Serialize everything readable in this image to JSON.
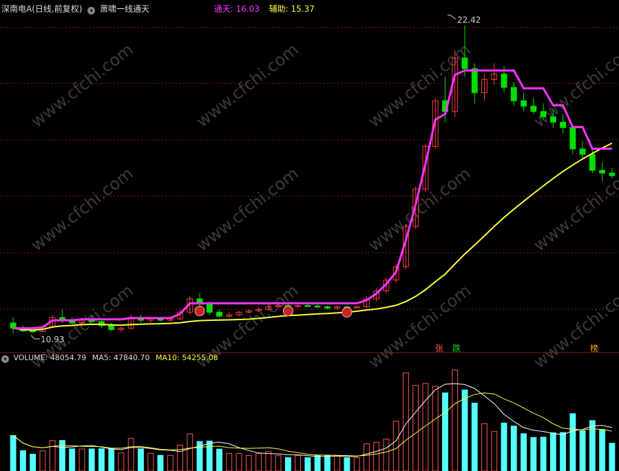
{
  "header": {
    "stock_title": "深南电A(日线,前复权)",
    "indicator_name": "萧啸一线通天",
    "tongtian_label": "通天:",
    "tongtian_value": "16.03",
    "fuzhu_label": "辅助:",
    "fuzhu_value": "15.37"
  },
  "volume_header": {
    "label": "VOLUME:",
    "value": "48054.79",
    "ma5_label": "MA5:",
    "ma5_value": "47840.70",
    "ma10_label": "MA10:",
    "ma10_value": "54255.08"
  },
  "annotations": {
    "high_price": "22.42",
    "low_price": "10.93",
    "marker_zhang": "张",
    "marker_die": "跌",
    "marker_bang": "榜"
  },
  "watermark": "www.cfchi.com",
  "colors": {
    "background": "#000000",
    "up_candle": "#ff3c3c",
    "down_candle": "#00e000",
    "flat_candle": "#ffffff",
    "tongtian_line": "#ff33ff",
    "fuzhu_line": "#ffff33",
    "volume_up": "#ff5555",
    "volume_down": "#55ffff",
    "gridline": "#8b1a1a"
  },
  "chart_data": [
    {
      "type": "candlestick",
      "title": "深南电A(日线,前复权)",
      "y_labeled_points": {
        "high": 22.42,
        "low": 10.93
      },
      "series": [
        {
          "name": "通天",
          "last_value": 16.03
        },
        {
          "name": "辅助",
          "last_value": 15.37
        }
      ],
      "candles": [
        [
          11.3,
          11.5,
          10.9,
          11.1
        ],
        [
          11.1,
          11.2,
          10.95,
          11.0
        ],
        [
          11.0,
          11.1,
          10.93,
          10.98
        ],
        [
          10.98,
          11.2,
          10.95,
          11.15
        ],
        [
          11.15,
          11.6,
          11.1,
          11.5
        ],
        [
          11.5,
          11.8,
          11.3,
          11.4
        ],
        [
          11.4,
          11.5,
          11.2,
          11.3
        ],
        [
          11.3,
          11.5,
          11.2,
          11.45
        ],
        [
          11.45,
          11.6,
          11.3,
          11.35
        ],
        [
          11.35,
          11.4,
          11.1,
          11.2
        ],
        [
          11.2,
          11.3,
          11.0,
          11.05
        ],
        [
          11.05,
          11.15,
          10.95,
          11.1
        ],
        [
          11.1,
          11.6,
          11.05,
          11.5
        ],
        [
          11.5,
          11.6,
          11.3,
          11.4
        ],
        [
          11.4,
          11.5,
          11.3,
          11.45
        ],
        [
          11.45,
          11.5,
          11.35,
          11.4
        ],
        [
          11.4,
          11.5,
          11.35,
          11.45
        ],
        [
          11.45,
          11.8,
          11.4,
          11.7
        ],
        [
          11.7,
          12.3,
          11.6,
          12.2
        ],
        [
          12.2,
          12.4,
          11.9,
          12.0
        ],
        [
          12.0,
          12.1,
          11.6,
          11.7
        ],
        [
          11.7,
          11.8,
          11.5,
          11.55
        ],
        [
          11.55,
          11.7,
          11.5,
          11.6
        ],
        [
          11.6,
          11.75,
          11.55,
          11.7
        ],
        [
          11.7,
          11.8,
          11.65,
          11.75
        ],
        [
          11.75,
          11.9,
          11.7,
          11.8
        ],
        [
          11.8,
          12.0,
          11.75,
          11.9
        ],
        [
          11.9,
          12.0,
          11.85,
          11.95
        ],
        [
          11.95,
          12.0,
          11.9,
          11.92
        ],
        [
          11.92,
          12.0,
          11.85,
          11.95
        ],
        [
          11.95,
          12.0,
          11.9,
          11.93
        ],
        [
          11.93,
          12.0,
          11.85,
          11.9
        ],
        [
          11.9,
          11.95,
          11.8,
          11.85
        ],
        [
          11.85,
          11.95,
          11.8,
          11.9
        ],
        [
          11.9,
          11.95,
          11.85,
          11.88
        ],
        [
          11.88,
          11.95,
          11.85,
          11.9
        ],
        [
          11.9,
          12.3,
          11.85,
          12.2
        ],
        [
          12.2,
          12.6,
          12.1,
          12.5
        ],
        [
          12.5,
          13.0,
          12.4,
          12.9
        ],
        [
          12.9,
          13.5,
          12.8,
          13.4
        ],
        [
          13.4,
          15.0,
          13.3,
          14.9
        ],
        [
          14.9,
          16.4,
          14.8,
          16.3
        ],
        [
          16.3,
          18.0,
          16.2,
          17.9
        ],
        [
          17.9,
          19.7,
          17.8,
          19.6
        ],
        [
          19.6,
          20.5,
          18.8,
          19.2
        ],
        [
          19.2,
          21.5,
          19.0,
          21.2
        ],
        [
          21.2,
          22.42,
          20.5,
          20.8
        ],
        [
          20.8,
          21.0,
          19.5,
          19.9
        ],
        [
          19.9,
          20.6,
          19.6,
          20.4
        ],
        [
          20.4,
          21.0,
          20.2,
          20.6
        ],
        [
          20.6,
          20.9,
          19.9,
          20.1
        ],
        [
          20.1,
          20.3,
          19.4,
          19.6
        ],
        [
          19.6,
          19.9,
          19.2,
          19.4
        ],
        [
          19.4,
          19.7,
          19.1,
          19.2
        ],
        [
          19.2,
          19.5,
          18.9,
          19.0
        ],
        [
          19.0,
          19.3,
          18.6,
          18.8
        ],
        [
          18.8,
          19.1,
          18.4,
          18.6
        ],
        [
          18.6,
          18.7,
          17.6,
          17.8
        ],
        [
          17.8,
          18.1,
          17.4,
          17.6
        ],
        [
          17.6,
          17.8,
          16.9,
          17.0
        ],
        [
          17.0,
          17.3,
          16.6,
          16.9
        ],
        [
          16.9,
          17.1,
          16.7,
          16.8
        ]
      ]
    },
    {
      "type": "bar",
      "title": "VOLUME",
      "series": [
        {
          "name": "VOLUME",
          "last_value": 48054.79
        },
        {
          "name": "MA5",
          "last_value": 47840.7
        },
        {
          "name": "MA10",
          "last_value": 54255.08
        }
      ]
    }
  ]
}
